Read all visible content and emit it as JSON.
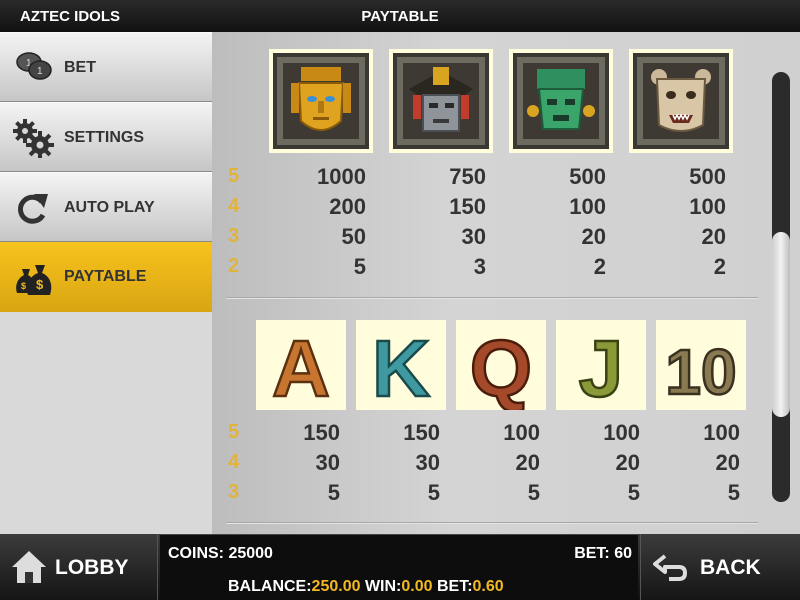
{
  "header": {
    "game_title": "AZTEC IDOLS",
    "page_title": "PAYTABLE"
  },
  "sidebar": {
    "items": [
      {
        "label": "BET",
        "icon": "coins-icon",
        "active": false
      },
      {
        "label": "SETTINGS",
        "icon": "gears-icon",
        "active": false
      },
      {
        "label": "AUTO PLAY",
        "icon": "refresh-icon",
        "active": false
      },
      {
        "label": "PAYTABLE",
        "icon": "money-bags-icon",
        "active": true
      }
    ]
  },
  "paytable": {
    "high_symbols": [
      {
        "name": "golden-mask",
        "pays": [
          "1000",
          "200",
          "50",
          "5"
        ]
      },
      {
        "name": "stone-warrior-mask",
        "pays": [
          "750",
          "150",
          "30",
          "3"
        ]
      },
      {
        "name": "jade-mask",
        "pays": [
          "500",
          "100",
          "20",
          "2"
        ]
      },
      {
        "name": "jaguar-mask",
        "pays": [
          "500",
          "100",
          "20",
          "2"
        ]
      }
    ],
    "high_counts": [
      "5",
      "4",
      "3",
      "2"
    ],
    "low_symbols": [
      {
        "name": "A",
        "pays": [
          "150",
          "30",
          "5"
        ]
      },
      {
        "name": "K",
        "pays": [
          "150",
          "30",
          "5"
        ]
      },
      {
        "name": "Q",
        "pays": [
          "100",
          "20",
          "5"
        ]
      },
      {
        "name": "J",
        "pays": [
          "100",
          "20",
          "5"
        ]
      },
      {
        "name": "10",
        "pays": [
          "100",
          "20",
          "5"
        ]
      }
    ],
    "low_counts": [
      "5",
      "4",
      "3"
    ],
    "colors": {
      "count": "#e2b33a",
      "symbol_bg": "#fffddb",
      "active_menu": "#f2bd1c"
    }
  },
  "footer": {
    "lobby_label": "LOBBY",
    "back_label": "BACK",
    "coins_label": "COINS:",
    "coins_value": "25000",
    "bet_label": "BET:",
    "bet_value": "60",
    "balance_label": "BALANCE:",
    "balance_value": "250.00",
    "win_label": "WIN:",
    "win_value": "0.00",
    "bet2_label": "BET:",
    "bet2_value": "0.60"
  }
}
